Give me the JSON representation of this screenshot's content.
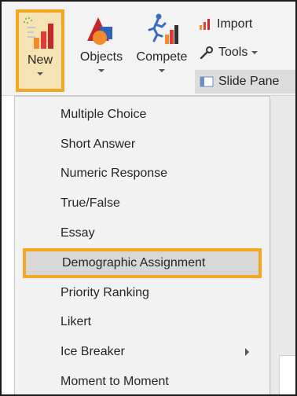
{
  "ribbon": {
    "new_label": "New",
    "objects_label": "Objects",
    "compete_label": "Compete",
    "import_label": "Import",
    "tools_label": "Tools",
    "slide_pane_label": "Slide Pane",
    "new_icon": "bar-chart-icon",
    "objects_icon": "shapes-icon",
    "compete_icon": "runner-chart-icon",
    "import_icon": "bar-chart-small-icon",
    "tools_icon": "wrench-icon",
    "slide_pane_icon": "slide-pane-icon",
    "highlight_color": "#f5a623"
  },
  "menu": {
    "items": [
      {
        "label": "Multiple Choice"
      },
      {
        "label": "Short Answer"
      },
      {
        "label": "Numeric Response"
      },
      {
        "label": "True/False"
      },
      {
        "label": "Essay"
      },
      {
        "label": "Demographic Assignment",
        "highlighted": true
      },
      {
        "label": "Priority Ranking"
      },
      {
        "label": "Likert"
      },
      {
        "label": "Ice Breaker",
        "has_submenu": true
      },
      {
        "label": "Moment to Moment"
      }
    ]
  }
}
